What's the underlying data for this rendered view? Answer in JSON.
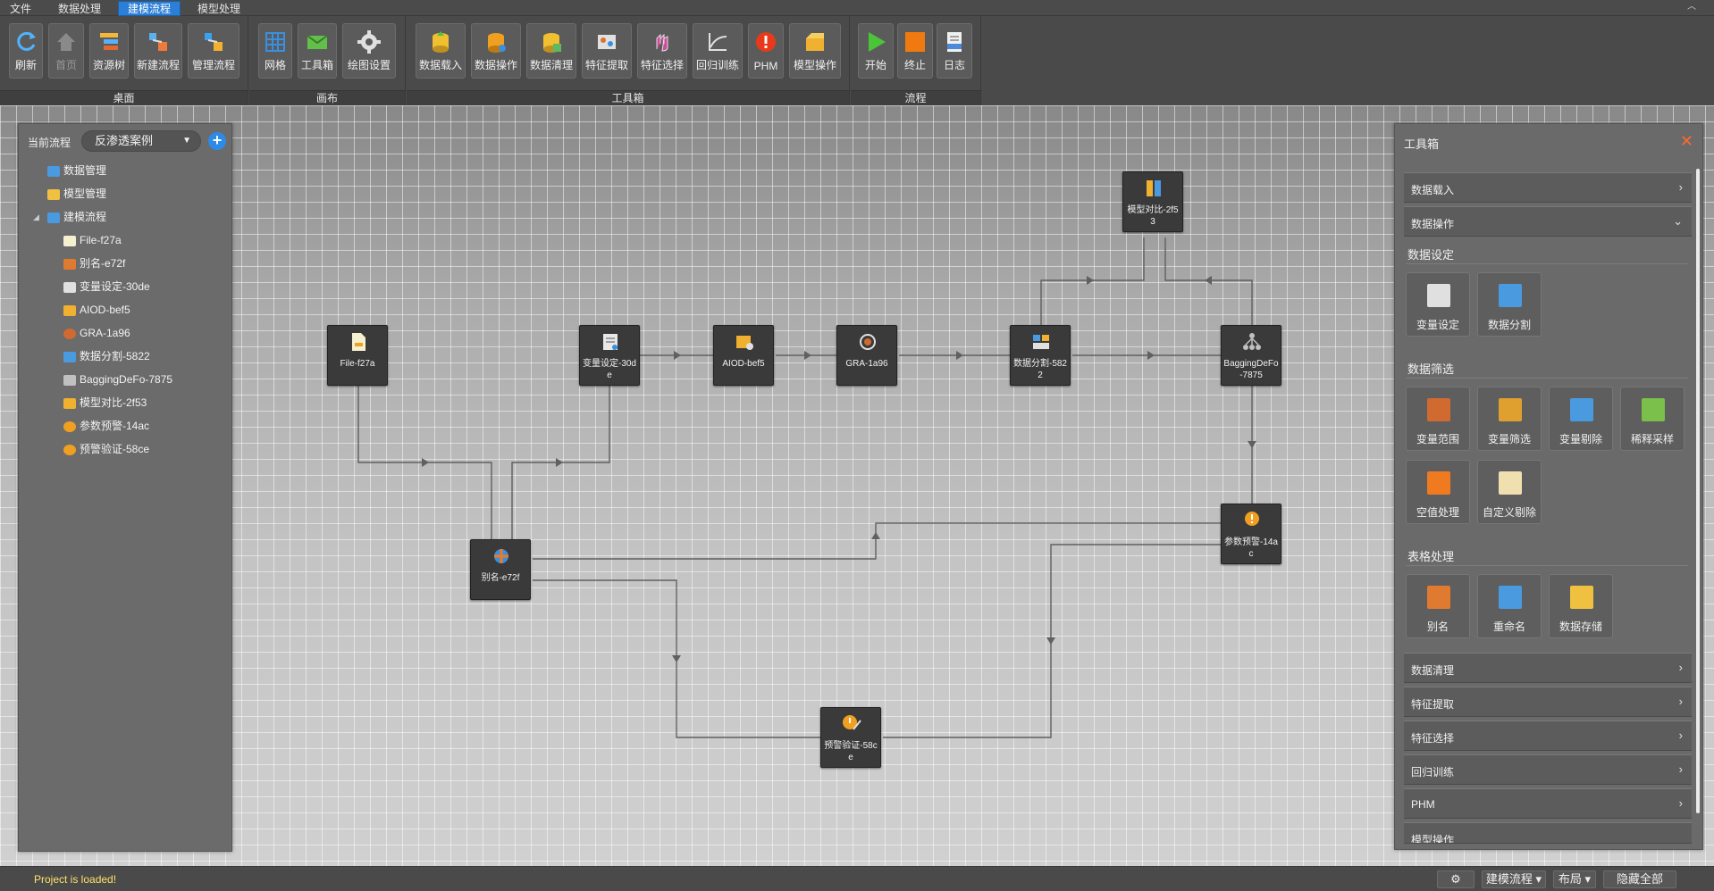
{
  "menu": {
    "tabs": [
      "文件",
      "数据处理",
      "建模流程",
      "模型处理"
    ],
    "active": 2
  },
  "ribbon": {
    "groups": [
      {
        "label": "桌面",
        "buttons": [
          {
            "label": "刷新",
            "icon": "refresh-icon",
            "color": "#4fb3ff"
          },
          {
            "label": "首页",
            "icon": "home-icon",
            "color": "#8a8a8a",
            "disabled": true
          },
          {
            "label": "资源树",
            "icon": "tree-icon",
            "color": "#f5b63a"
          },
          {
            "label": "新建流程",
            "icon": "new-flow-icon",
            "color": "#f07a3a"
          },
          {
            "label": "管理流程",
            "icon": "manage-flow-icon",
            "color": "#3aa0f0"
          }
        ]
      },
      {
        "label": "画布",
        "buttons": [
          {
            "label": "网格",
            "icon": "grid-icon",
            "color": "#3a8fe0"
          },
          {
            "label": "工具箱",
            "icon": "toolbox-icon",
            "color": "#62c04a"
          },
          {
            "label": "绘图设置",
            "icon": "gear-icon",
            "color": "#e0e0e0"
          }
        ]
      },
      {
        "label": "工具箱",
        "buttons": [
          {
            "label": "数据载入",
            "icon": "data-load-icon",
            "color": "#f0c030"
          },
          {
            "label": "数据操作",
            "icon": "data-op-icon",
            "color": "#f0a020"
          },
          {
            "label": "数据清理",
            "icon": "data-clean-icon",
            "color": "#60b860"
          },
          {
            "label": "特征提取",
            "icon": "feature-extract-icon",
            "color": "#e07030"
          },
          {
            "label": "特征选择",
            "icon": "feature-select-icon",
            "color": "#d04a9a"
          },
          {
            "label": "回归训练",
            "icon": "regression-icon",
            "color": "#e0e0e0"
          },
          {
            "label": "PHM",
            "icon": "alert-icon",
            "color": "#e83a1a"
          },
          {
            "label": "模型操作",
            "icon": "model-op-icon",
            "color": "#f0b030"
          }
        ]
      },
      {
        "label": "流程",
        "buttons": [
          {
            "label": "开始",
            "icon": "play-icon",
            "color": "#4cc43a"
          },
          {
            "label": "终止",
            "icon": "stop-icon",
            "color": "#f07a10"
          },
          {
            "label": "日志",
            "icon": "log-icon",
            "color": "#4a8ad8"
          }
        ]
      }
    ]
  },
  "left_panel": {
    "flow_label": "当前流程",
    "flow_select": "反渗透案例",
    "add_icon": "plus-icon",
    "tree": [
      {
        "label": "数据管理",
        "level": 0,
        "color": "#4a9ae0"
      },
      {
        "label": "模型管理",
        "level": 0,
        "color": "#f0c040"
      },
      {
        "label": "建模流程",
        "level": 0,
        "color": "#4a9ae0",
        "expanded": true
      },
      {
        "label": "File-f27a",
        "level": 1,
        "color": "#f5f0d0"
      },
      {
        "label": "别名-e72f",
        "level": 1,
        "color": "#e07a30"
      },
      {
        "label": "变量设定-30de",
        "level": 1,
        "color": "#e0e0e0"
      },
      {
        "label": "AIOD-bef5",
        "level": 1,
        "color": "#f0b030"
      },
      {
        "label": "GRA-1a96",
        "level": 1,
        "color": "#d06a30"
      },
      {
        "label": "数据分割-5822",
        "level": 1,
        "color": "#4a9ae0"
      },
      {
        "label": "BaggingDeFo-7875",
        "level": 1,
        "color": "#c0c0c0"
      },
      {
        "label": "模型对比-2f53",
        "level": 1,
        "color": "#f0b030"
      },
      {
        "label": "参数预警-14ac",
        "level": 1,
        "color": "#f0a020"
      },
      {
        "label": "预警验证-58ce",
        "level": 1,
        "color": "#f0a020"
      }
    ]
  },
  "canvas": {
    "nodes": [
      {
        "id": "file",
        "label": "File-f27a",
        "icon": "file-icon",
        "color": "#f5f0d0"
      },
      {
        "id": "vars",
        "label": "变量设定-30de",
        "icon": "variable-icon",
        "color": "#e8e8e8"
      },
      {
        "id": "aiod",
        "label": "AIOD-bef5",
        "icon": "aiod-icon",
        "color": "#f0b030"
      },
      {
        "id": "gra",
        "label": "GRA-1a96",
        "icon": "gra-icon",
        "color": "#d06a30"
      },
      {
        "id": "split",
        "label": "数据分割-5822",
        "icon": "split-icon",
        "color": "#4a9ae0"
      },
      {
        "id": "bagging",
        "label": "BaggingDeFo-7875",
        "icon": "bagging-icon",
        "color": "#c0c0c0"
      },
      {
        "id": "compare",
        "label": "模型对比-2f53",
        "icon": "compare-icon",
        "color": "#f0b030"
      },
      {
        "id": "alias",
        "label": "别名-e72f",
        "icon": "alias-icon",
        "color": "#3a8fe0"
      },
      {
        "id": "warn",
        "label": "参数预警-14ac",
        "icon": "warning-icon",
        "color": "#f0a020"
      },
      {
        "id": "verify",
        "label": "预警验证-58ce",
        "icon": "verify-icon",
        "color": "#f0a020"
      }
    ]
  },
  "toolbox": {
    "title": "工具箱",
    "close_icon": "close-icon",
    "top_accordions": [
      {
        "label": "数据载入",
        "expanded": false
      },
      {
        "label": "数据操作",
        "expanded": true
      }
    ],
    "sections": [
      {
        "title": "数据设定",
        "tools": [
          {
            "label": "变量设定",
            "icon": "variable-setting-icon",
            "color": "#e0e0e0"
          },
          {
            "label": "数据分割",
            "icon": "data-split-icon",
            "color": "#4a9ae0"
          }
        ]
      },
      {
        "title": "数据筛选",
        "tools": [
          {
            "label": "变量范围",
            "icon": "variable-range-icon",
            "color": "#d06a30"
          },
          {
            "label": "变量筛选",
            "icon": "variable-filter-icon",
            "color": "#e0a030"
          },
          {
            "label": "变量剔除",
            "icon": "variable-remove-icon",
            "color": "#4a9ae0"
          },
          {
            "label": "稀释采样",
            "icon": "dilute-sample-icon",
            "color": "#7ac04a"
          },
          {
            "label": "空值处理",
            "icon": "null-process-icon",
            "color": "#f07a20"
          },
          {
            "label": "自定义剔除",
            "icon": "custom-remove-icon",
            "color": "#f0e0b0"
          }
        ]
      },
      {
        "title": "表格处理",
        "tools": [
          {
            "label": "别名",
            "icon": "alias-icon",
            "color": "#e07a30"
          },
          {
            "label": "重命名",
            "icon": "rename-icon",
            "color": "#4a9ae0"
          },
          {
            "label": "数据存储",
            "icon": "data-store-icon",
            "color": "#f0c040"
          }
        ]
      }
    ],
    "bottom_accordions": [
      {
        "label": "数据清理"
      },
      {
        "label": "特征提取"
      },
      {
        "label": "特征选择"
      },
      {
        "label": "回归训练"
      },
      {
        "label": "PHM"
      },
      {
        "label": "模型操作"
      }
    ]
  },
  "status": {
    "message": "Project is loaded!",
    "buttons": [
      {
        "label": "",
        "icon": "gear-icon"
      },
      {
        "label": "建模流程 ▾"
      },
      {
        "label": "布局 ▾"
      },
      {
        "label": "隐藏全部"
      }
    ]
  }
}
